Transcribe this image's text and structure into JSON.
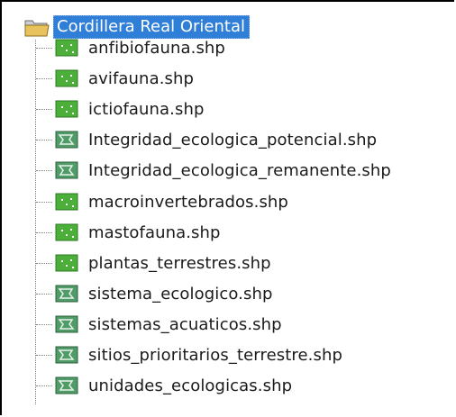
{
  "tree": {
    "root": {
      "label": "Cordillera Real Oriental",
      "icon": "folder-icon",
      "selected": true
    },
    "items": [
      {
        "label": "anfibiofauna.shp",
        "icon": "point-layer-icon"
      },
      {
        "label": "avifauna.shp",
        "icon": "point-layer-icon"
      },
      {
        "label": "ictiofauna.shp",
        "icon": "point-layer-icon"
      },
      {
        "label": "Integridad_ecologica_potencial.shp",
        "icon": "polygon-layer-icon"
      },
      {
        "label": "Integridad_ecologica_remanente.shp",
        "icon": "polygon-layer-icon"
      },
      {
        "label": "macroinvertebrados.shp",
        "icon": "point-layer-icon"
      },
      {
        "label": "mastofauna.shp",
        "icon": "point-layer-icon"
      },
      {
        "label": "plantas_terrestres.shp",
        "icon": "point-layer-icon"
      },
      {
        "label": "sistema_ecologico.shp",
        "icon": "polygon-layer-icon"
      },
      {
        "label": "sistemas_acuaticos.shp",
        "icon": "polygon-layer-icon"
      },
      {
        "label": "sitios_prioritarios_terrestre.shp",
        "icon": "polygon-layer-icon"
      },
      {
        "label": "unidades_ecologicas.shp",
        "icon": "polygon-layer-icon"
      }
    ],
    "colors": {
      "selection": "#2f7ed8",
      "point_icon": "#4caf3a",
      "polygon_icon": "#4f9c68",
      "folder": "#e8c25c"
    }
  }
}
